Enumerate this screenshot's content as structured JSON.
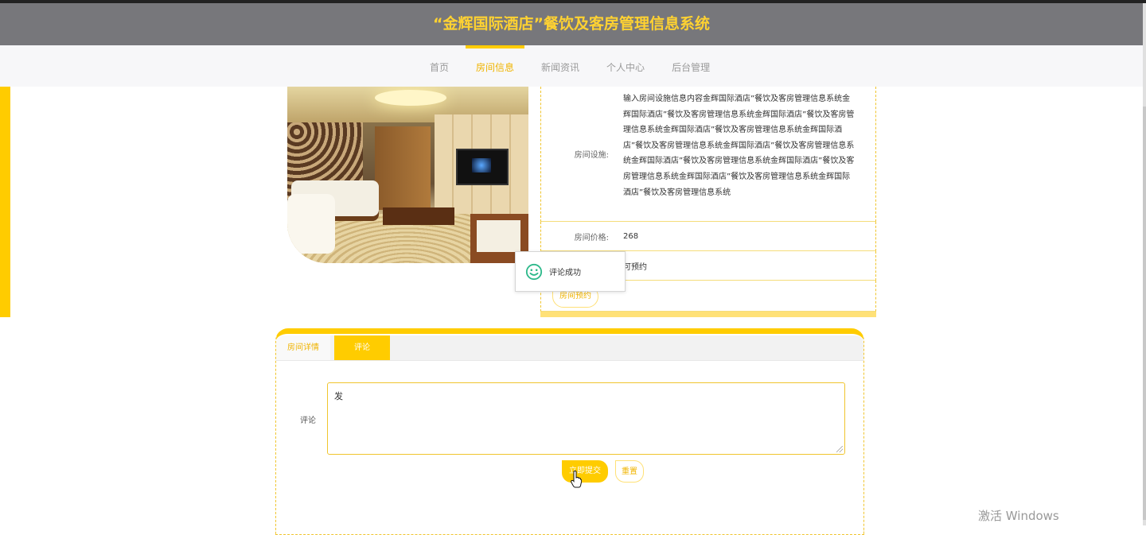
{
  "header": {
    "title": "“金辉国际酒店”餐饮及客房管理信息系统"
  },
  "nav": {
    "items": [
      {
        "label": "首页"
      },
      {
        "label": "房间信息"
      },
      {
        "label": "新闻资讯"
      },
      {
        "label": "个人中心"
      },
      {
        "label": "后台管理"
      }
    ],
    "active": "房间信息"
  },
  "room": {
    "facilities_label": "房间设施:",
    "facilities_value": "输入房间设施信息内容金辉国际酒店”餐饮及客房管理信息系统金辉国际酒店”餐饮及客房管理信息系统金辉国际酒店”餐饮及客房管理信息系统金辉国际酒店”餐饮及客房管理信息系统金辉国际酒店”餐饮及客房管理信息系统金辉国际酒店”餐饮及客房管理信息系统金辉国际酒店”餐饮及客房管理信息系统金辉国际酒店”餐饮及客房管理信息系统金辉国际酒店”餐饮及客房管理信息系统金辉国际酒店”餐饮及客房管理信息系统",
    "price_label": "房间价格:",
    "price_value": "268",
    "status_value": "可预约",
    "book_button": "房间预约"
  },
  "toast": {
    "text": "评论成功",
    "icon": "smile-icon"
  },
  "tabs": [
    {
      "label": "房间详情"
    },
    {
      "label": "评论"
    }
  ],
  "comment": {
    "label": "评论",
    "value": "发",
    "submit": "立即提交",
    "reset": "重置"
  },
  "watermark": "激活 Windows",
  "colors": {
    "accent": "#ffcc00",
    "header_bg": "#77777b",
    "title": "#ffd231"
  }
}
